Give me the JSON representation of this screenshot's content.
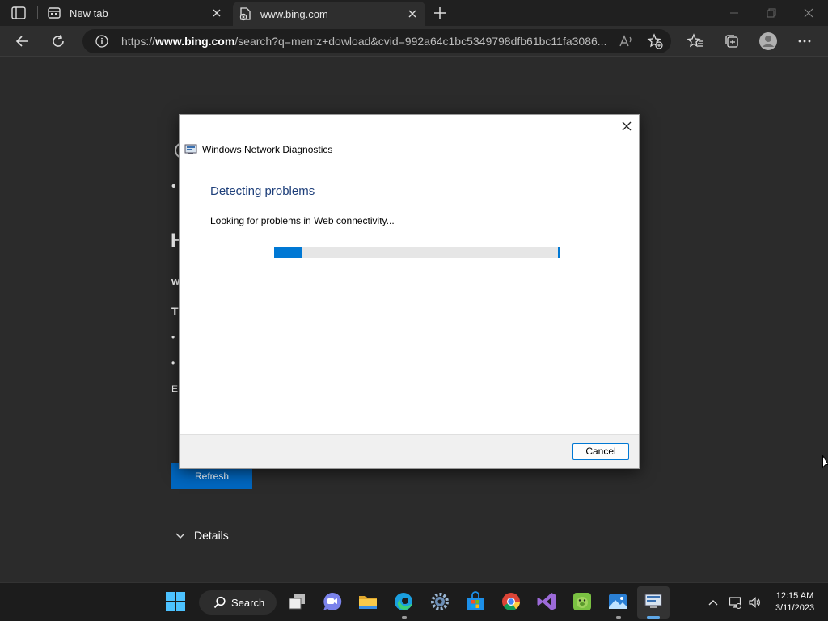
{
  "browser": {
    "tabs": [
      {
        "label": "New tab"
      },
      {
        "label": "www.bing.com"
      }
    ],
    "address_bar": {
      "url_prefix": "https://",
      "url_host": "www.bing.com",
      "url_rest": "/search?q=memz+dowload&cvid=992a64c1bc5349798dfb61bc11fa3086..."
    }
  },
  "page": {
    "refresh_label": "Refresh",
    "details_label": "Details",
    "peek_letters": [
      "H",
      "w",
      "T",
      "•",
      "•",
      "•",
      "EF"
    ]
  },
  "dialog": {
    "title": "Windows Network Diagnostics",
    "heading": "Detecting problems",
    "status": "Looking for problems in Web connectivity...",
    "progress_fraction": 0.1,
    "cancel_label": "Cancel"
  },
  "taskbar": {
    "search_label": "Search",
    "clock": {
      "time": "12:15 AM",
      "date": "3/11/2023"
    }
  },
  "colors": {
    "accent": "#0078d4",
    "dialog_heading": "#1e3f7a",
    "browser_bg": "#2b2b2b"
  }
}
